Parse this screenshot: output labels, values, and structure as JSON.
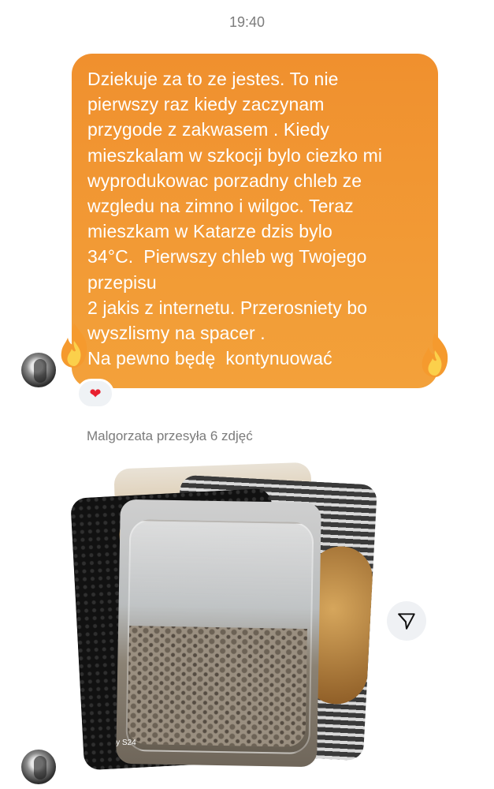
{
  "conversation": {
    "timestamp": "19:40"
  },
  "message": {
    "lines": [
      "Dziekuje za to ze jestes. To nie",
      "pierwszy raz kiedy zaczynam",
      "przygode z zakwasem . Kiedy",
      "mieszkalam w szkocji bylo ciezko mi",
      "wyprodukowac porzadny chleb ze",
      "wzgledu na zimno i wilgoc. Teraz",
      "mieszkam w Katarze dzis bylo",
      "34°C.  Pierwszy chleb wg Twojego",
      "przepisu",
      "2 jakis z internetu. Przerosniety bo",
      "wyszlismy na spacer .",
      "Na pewno będę  kontynuować"
    ],
    "reaction": "❤",
    "effect_icon": "fire-icon"
  },
  "photo_group": {
    "caption": "Malgorzata przesyła 6 zdjęć",
    "watermark": "xy S24xy S24"
  },
  "icons": {
    "share": "paper-plane-icon",
    "avatar": "avatar"
  },
  "colors": {
    "bubble_top": "#f0902e",
    "bubble_bottom": "#f3a13a",
    "timestamp": "#7c7c7c",
    "caption": "#7b7b7b",
    "heart": "#e8202f"
  }
}
